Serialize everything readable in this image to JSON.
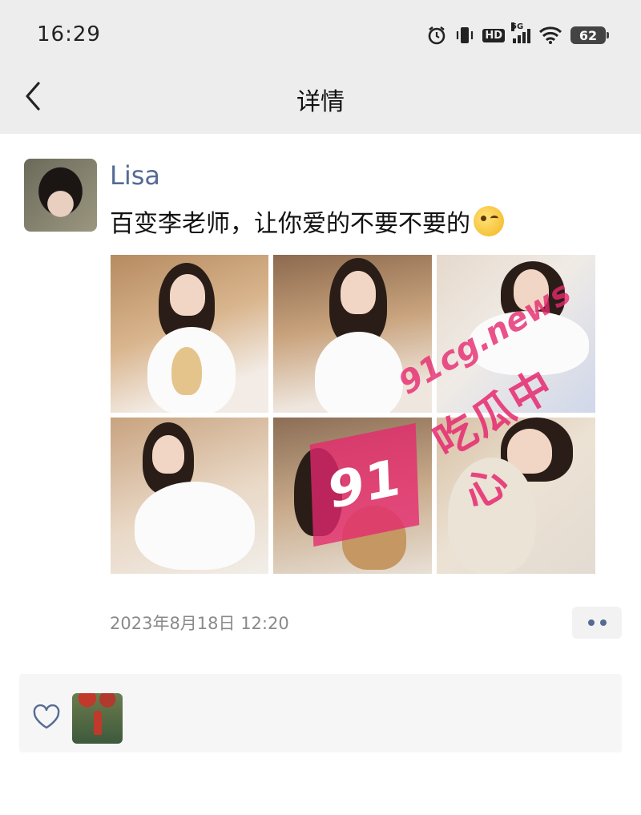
{
  "status_bar": {
    "time": "16:29",
    "network": "5G",
    "hd": "HD",
    "battery": "62"
  },
  "nav": {
    "title": "详情"
  },
  "post": {
    "username": "Lisa",
    "text": "百变李老师，让你爱的不要不要的",
    "emoji": "winking-face-emoji",
    "photo_count": 6,
    "watermark": {
      "badge": "91",
      "site": "91cg.news",
      "brand": "吃瓜中心"
    },
    "timestamp": "2023年8月18日 12:20"
  },
  "likes": {
    "count_shown": 1
  },
  "colors": {
    "header_bg": "#ededed",
    "username": "#566b94",
    "timestamp": "#8a8a8a",
    "watermark": "#e6286e"
  }
}
